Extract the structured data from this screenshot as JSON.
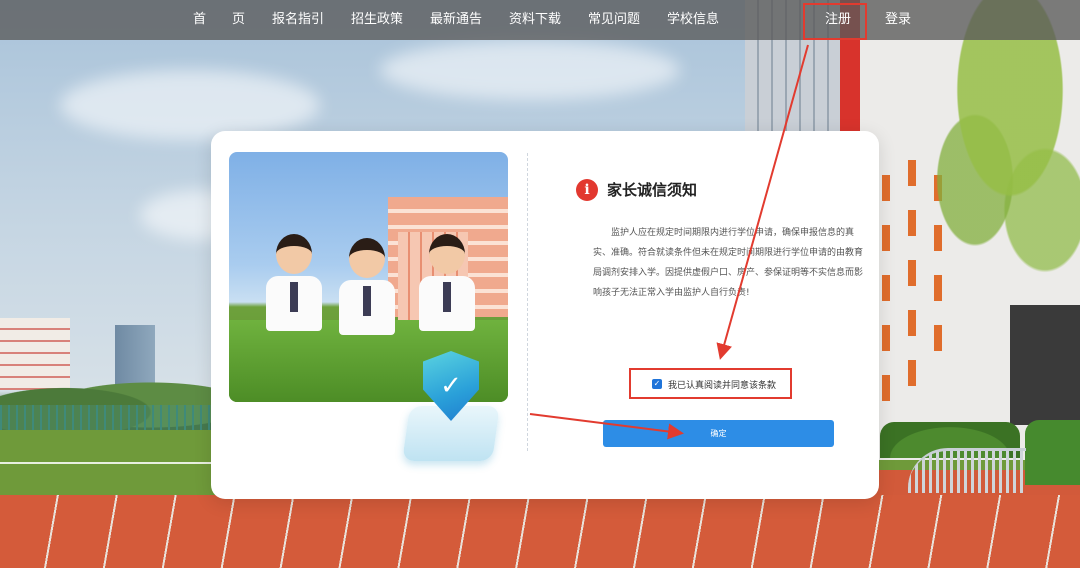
{
  "nav": {
    "items": [
      "首　　页",
      "报名指引",
      "招生政策",
      "最新通告",
      "资料下载",
      "常见问题",
      "学校信息"
    ],
    "register": "注册",
    "login": "登录"
  },
  "notice": {
    "icon": "info-icon",
    "icon_glyph": "i",
    "title": "家长诚信须知",
    "body": "监护人应在规定时间期限内进行学位申请，确保申报信息的真实、准确。符合就读条件但未在规定时间期限进行学位申请的由教育局调剂安排入学。因提供虚假户口、房产、参保证明等不实信息而影响孩子无法正常入学由监护人自行负责!"
  },
  "agree": {
    "checked": true,
    "label": "我已认真阅读并同意该条款"
  },
  "confirm": {
    "label": "确定"
  },
  "colors": {
    "primary": "#2d8de6",
    "annotation": "#e23b2f",
    "nav_bg": "rgba(90,90,90,0.78)"
  }
}
